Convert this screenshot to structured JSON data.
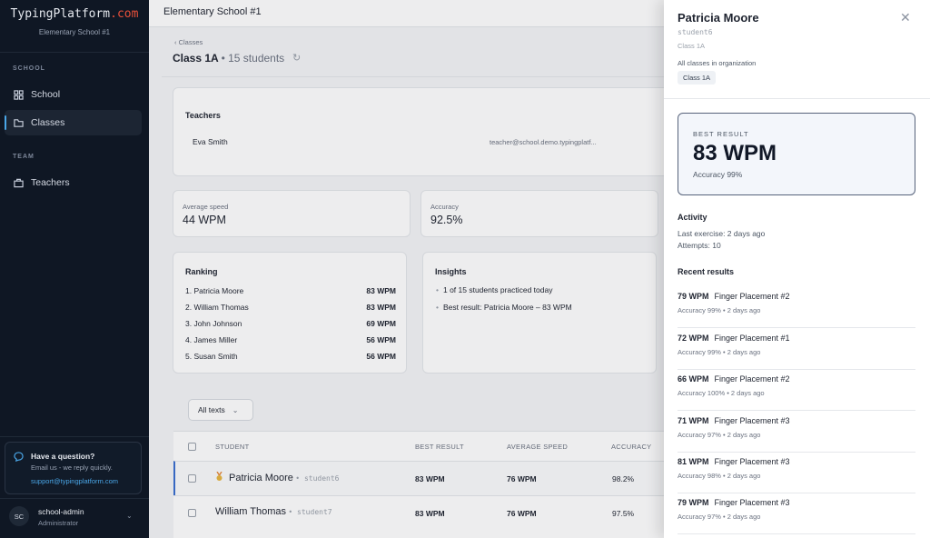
{
  "sidebar": {
    "logo_main": "TypingPlatform",
    "logo_accent": ".com",
    "org_name": "Elementary School #1",
    "section_school": "SCHOOL",
    "section_team": "TEAM",
    "nav": {
      "school": "School",
      "classes": "Classes",
      "teachers": "Teachers"
    },
    "help": {
      "title": "Have a question?",
      "subtitle": "Email us - we reply quickly.",
      "email": "support@typingplatform.com"
    },
    "user": {
      "initials": "SC",
      "name": "school-admin",
      "role": "Administrator"
    }
  },
  "header": {
    "title": "Elementary School #1"
  },
  "page": {
    "breadcrumb": "Classes",
    "class_name": "Class 1A",
    "class_count": "• 15 students"
  },
  "teachers_panel": {
    "title": "Teachers",
    "name": "Eva Smith",
    "email": "teacher@school.demo.typingplatf..."
  },
  "stats": {
    "avg_label": "Average speed",
    "avg_value": "44 WPM",
    "acc_label": "Accuracy",
    "acc_value": "92.5%"
  },
  "ranking": {
    "title": "Ranking",
    "rows": [
      {
        "name": "1. Patricia Moore",
        "wpm": "83 WPM"
      },
      {
        "name": "2. William Thomas",
        "wpm": "83 WPM"
      },
      {
        "name": "3. John Johnson",
        "wpm": "69 WPM"
      },
      {
        "name": "4. James Miller",
        "wpm": "56 WPM"
      },
      {
        "name": "5. Susan Smith",
        "wpm": "56 WPM"
      }
    ]
  },
  "insights": {
    "title": "Insights",
    "items": [
      "1 of 15 students practiced today",
      "Best result: Patricia Moore – 83 WPM"
    ]
  },
  "filter": {
    "label": "All texts"
  },
  "table": {
    "headers": {
      "student": "STUDENT",
      "best": "BEST RESULT",
      "avg": "AVERAGE SPEED",
      "acc": "ACCURACY"
    },
    "rows": [
      {
        "name": "Patricia Moore",
        "id": "student6",
        "best": "83 WPM",
        "avg": "76 WPM",
        "acc": "98.2%"
      },
      {
        "name": "William Thomas",
        "id": "student7",
        "best": "83 WPM",
        "avg": "76 WPM",
        "acc": "97.5%"
      }
    ]
  },
  "drawer": {
    "name": "Patricia Moore",
    "id": "student6",
    "class": "Class 1A",
    "all_classes_label": "All classes in organization",
    "chip": "Class 1A",
    "best_label": "BEST RESULT",
    "best_value": "83 WPM",
    "best_accuracy": "Accuracy 99%",
    "activity_title": "Activity",
    "last_exercise": "Last exercise: 2 days ago",
    "attempts": "Attempts: 10",
    "recent_title": "Recent results",
    "results": [
      {
        "wpm": "79 WPM",
        "text": "Finger Placement #2",
        "meta": "Accuracy 99% • 2 days ago"
      },
      {
        "wpm": "72 WPM",
        "text": "Finger Placement #1",
        "meta": "Accuracy 99% • 2 days ago"
      },
      {
        "wpm": "66 WPM",
        "text": "Finger Placement #2",
        "meta": "Accuracy 100% • 2 days ago"
      },
      {
        "wpm": "71 WPM",
        "text": "Finger Placement #3",
        "meta": "Accuracy 97% • 2 days ago"
      },
      {
        "wpm": "81 WPM",
        "text": "Finger Placement #3",
        "meta": "Accuracy 98% • 2 days ago"
      },
      {
        "wpm": "79 WPM",
        "text": "Finger Placement #3",
        "meta": "Accuracy 97% • 2 days ago"
      }
    ]
  },
  "colors": {
    "sidebar_bg": "#0f1724",
    "brand_accent": "#e8503a",
    "link": "#4aa7e8",
    "selected_row": "#3a6fd0"
  }
}
